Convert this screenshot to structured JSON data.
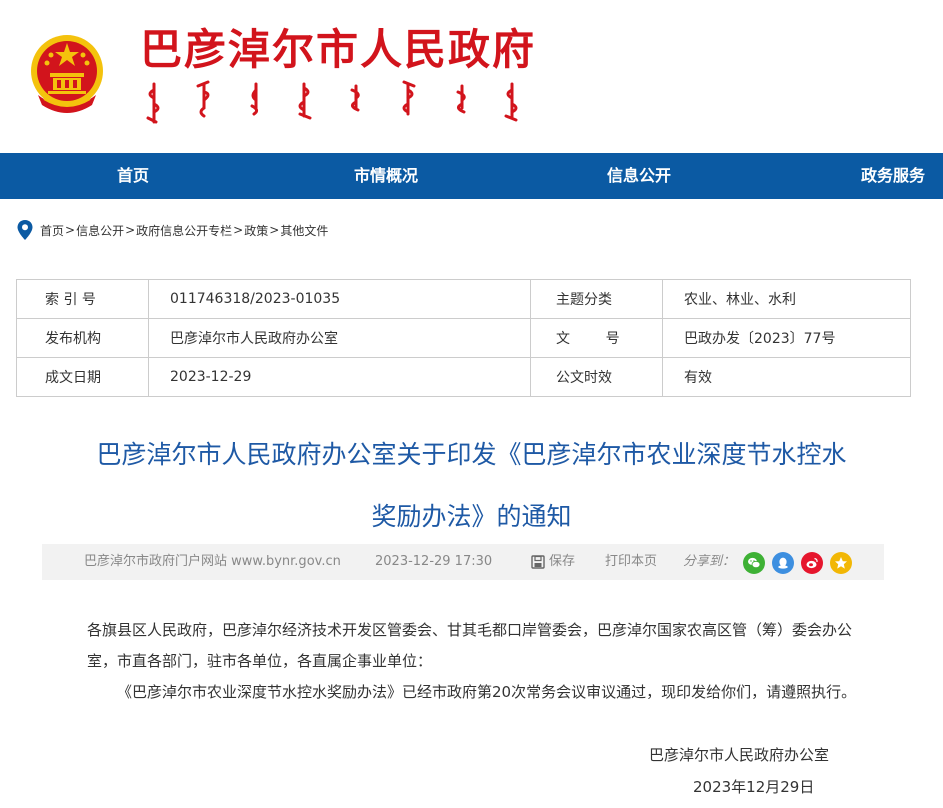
{
  "header": {
    "site_title": "巴彦淖尔市人民政府"
  },
  "nav": {
    "items": [
      "首页",
      "市情概况",
      "信息公开",
      "政务服务"
    ]
  },
  "breadcrumb": {
    "items": [
      "首页",
      "信息公开",
      "政府信息公开专栏",
      "政策",
      "其他文件"
    ],
    "separator": ">"
  },
  "info_table": {
    "rows": [
      {
        "k1": "索 引 号",
        "v1": "011746318/2023-01035",
        "k2": "主题分类",
        "v2": "农业、林业、水利"
      },
      {
        "k1": "发布机构",
        "v1": "巴彦淖尔市人民政府办公室",
        "k2": "文        号",
        "v2": "巴政办发〔2023〕77号"
      },
      {
        "k1": "成文日期",
        "v1": "2023-12-29",
        "k2": "公文时效",
        "v2": "有效"
      }
    ]
  },
  "document": {
    "title_line1": "巴彦淖尔市人民政府办公室关于印发《巴彦淖尔市农业深度节水控水",
    "title_line2": "奖励办法》的通知"
  },
  "meta": {
    "source": "巴彦淖尔市政府门户网站 www.bynr.gov.cn",
    "datetime": "2023-12-29 17:30",
    "save_label": "保存",
    "print_label": "打印本页",
    "share_label": "分享到："
  },
  "share_buttons": [
    {
      "name": "wechat",
      "color": "#3eb135"
    },
    {
      "name": "qq",
      "color": "#3d8fe0"
    },
    {
      "name": "weibo",
      "color": "#e6162d"
    },
    {
      "name": "qzone",
      "color": "#f2b705"
    }
  ],
  "body": {
    "paragraph1": "各旗县区人民政府，巴彦淖尔经济技术开发区管委会、甘其毛都口岸管委会，巴彦淖尔国家农高区管（筹）委会办公室，市直各部门，驻市各单位，各直属企事业单位：",
    "paragraph2": "《巴彦淖尔市农业深度节水控水奖励办法》已经市政府第20次常务会议审议通过，现印发给你们，请遵照执行。",
    "signature_org": "巴彦淖尔市人民政府办公室",
    "signature_date": "2023年12月29日"
  },
  "colors": {
    "brand_red": "#d2141c",
    "nav_blue": "#0b5aa3",
    "title_blue": "#1e59a5"
  }
}
